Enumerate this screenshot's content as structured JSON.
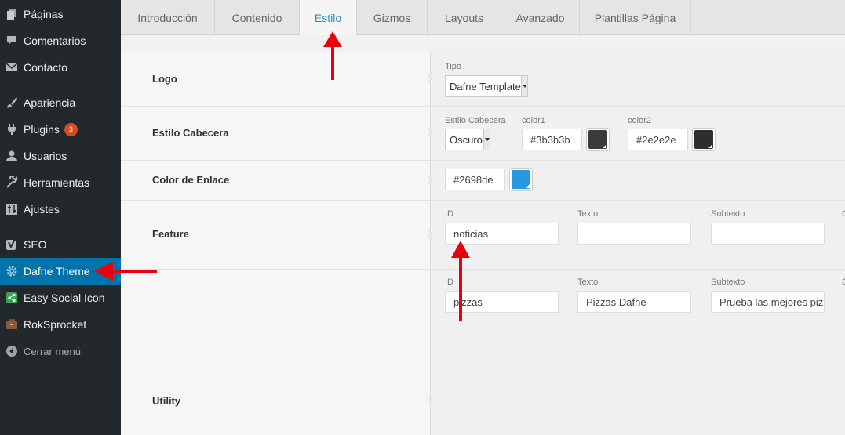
{
  "sidebar": {
    "items": [
      {
        "label": "Páginas",
        "icon": "pages-icon"
      },
      {
        "label": "Comentarios",
        "icon": "comments-icon"
      },
      {
        "label": "Contacto",
        "icon": "mail-icon"
      },
      {
        "label": "Apariencia",
        "icon": "paintbrush-icon"
      },
      {
        "label": "Plugins",
        "icon": "plugin-icon",
        "badge": "3"
      },
      {
        "label": "Usuarios",
        "icon": "user-icon"
      },
      {
        "label": "Herramientas",
        "icon": "wrench-icon"
      },
      {
        "label": "Ajustes",
        "icon": "settings-icon"
      },
      {
        "label": "SEO",
        "icon": "yoast-icon"
      },
      {
        "label": "Dafne Theme",
        "icon": "gear-icon",
        "active": true
      },
      {
        "label": "Easy Social Icon",
        "icon": "share-icon"
      },
      {
        "label": "RokSprocket",
        "icon": "briefcase-icon"
      },
      {
        "label": "Cerrar menú",
        "icon": "collapse-icon"
      }
    ]
  },
  "tabs": [
    "Introducción",
    "Contenido",
    "Estilo",
    "Gizmos",
    "Layouts",
    "Avanzado",
    "Plantillas Página"
  ],
  "active_tab": "Estilo",
  "rows": {
    "logo": {
      "label": "Logo",
      "tipo_label": "Tipo",
      "tipo_value": "Dafne Template"
    },
    "cabecera": {
      "label": "Estilo Cabecera",
      "estilo_label": "Estilo Cabecera",
      "estilo_value": "Oscuro",
      "color1_label": "color1",
      "color1_value": "#3b3b3b",
      "color2_label": "color2",
      "color2_value": "#2e2e2e"
    },
    "enlace": {
      "label": "Color de Enlace",
      "color_value": "#2698de"
    },
    "feature": {
      "label": "Feature",
      "entries": [
        {
          "id_label": "ID",
          "id_value": "noticias",
          "texto_label": "Texto",
          "texto_value": "",
          "subtexto_label": "Subtexto",
          "subtexto_value": "",
          "extra_label": "C"
        },
        {
          "id_label": "ID",
          "id_value": "pizzas",
          "texto_label": "Texto",
          "texto_value": "Pizzas Dafne",
          "subtexto_label": "Subtexto",
          "subtexto_value": "Prueba las mejores pizz",
          "extra_label": "C"
        }
      ]
    },
    "utility": {
      "label": "Utility"
    }
  },
  "colors": {
    "sidebar_bg": "#23282d",
    "active_bg": "#0073aa",
    "annotation_arrow": "#e8000c",
    "swatch_color1": "#3b3b3b",
    "swatch_color2": "#2e2e2e",
    "swatch_link": "#2698de"
  }
}
